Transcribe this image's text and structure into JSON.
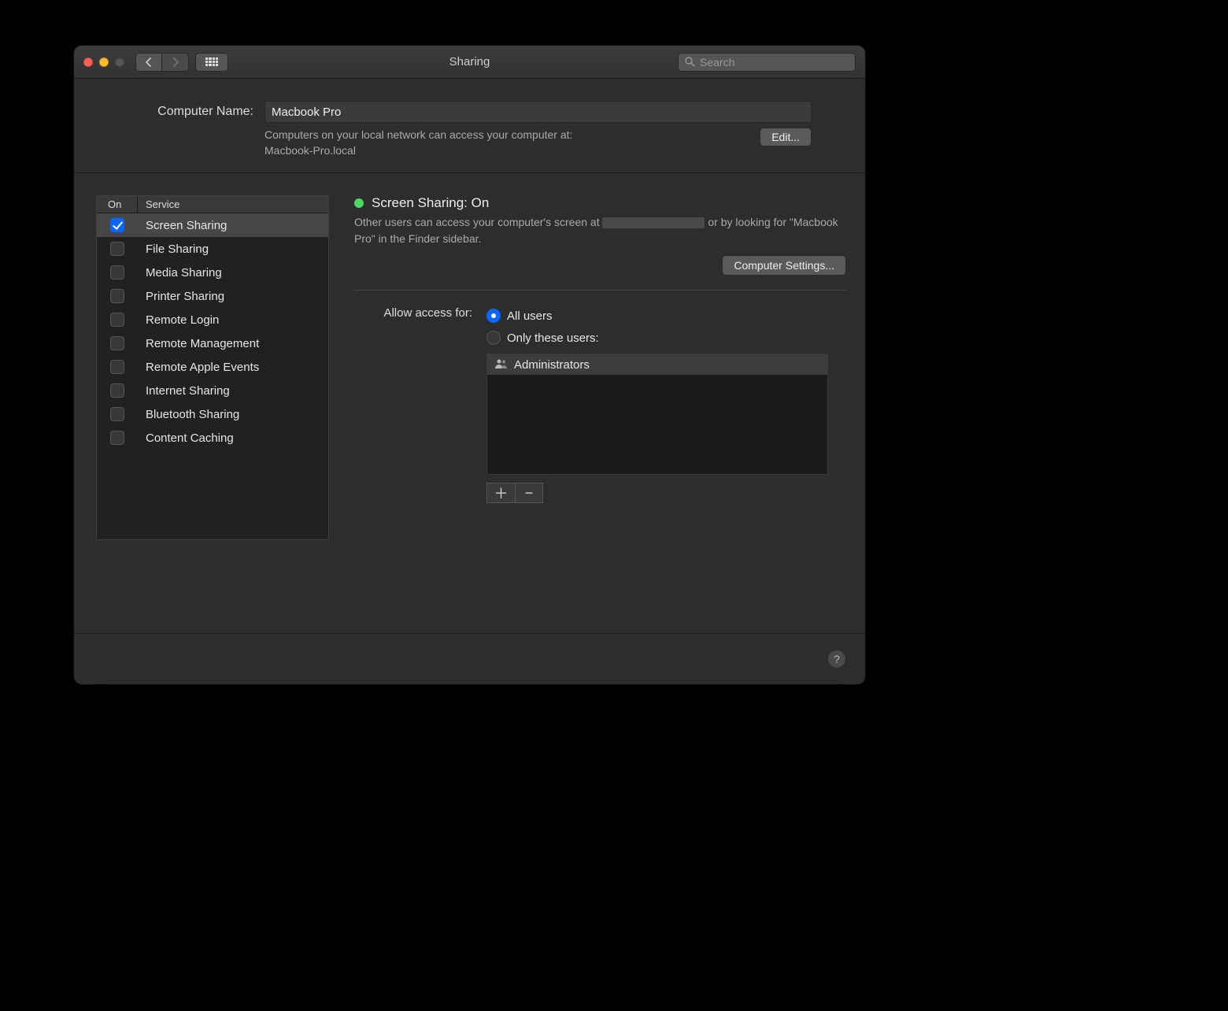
{
  "window": {
    "title": "Sharing"
  },
  "search": {
    "placeholder": "Search"
  },
  "computer_name": {
    "label": "Computer Name:",
    "value": "Macbook Pro",
    "sub_line1": "Computers on your local network can access your computer at:",
    "sub_line2": "Macbook-Pro.local",
    "edit_button": "Edit..."
  },
  "services": {
    "columns": {
      "on": "On",
      "service": "Service"
    },
    "items": [
      {
        "label": "Screen Sharing",
        "checked": true,
        "selected": true
      },
      {
        "label": "File Sharing",
        "checked": false,
        "selected": false
      },
      {
        "label": "Media Sharing",
        "checked": false,
        "selected": false
      },
      {
        "label": "Printer Sharing",
        "checked": false,
        "selected": false
      },
      {
        "label": "Remote Login",
        "checked": false,
        "selected": false
      },
      {
        "label": "Remote Management",
        "checked": false,
        "selected": false
      },
      {
        "label": "Remote Apple Events",
        "checked": false,
        "selected": false
      },
      {
        "label": "Internet Sharing",
        "checked": false,
        "selected": false
      },
      {
        "label": "Bluetooth Sharing",
        "checked": false,
        "selected": false
      },
      {
        "label": "Content Caching",
        "checked": false,
        "selected": false
      }
    ]
  },
  "detail": {
    "status_title": "Screen Sharing: On",
    "status_color": "#4cd964",
    "desc_pre": "Other users can access your computer's screen at ",
    "desc_post": " or by looking for \"Macbook Pro\" in the Finder sidebar.",
    "computer_settings_button": "Computer Settings...",
    "access_label": "Allow access for:",
    "option_all": "All users",
    "option_only": "Only these users:",
    "selected_option": "all",
    "users": [
      {
        "label": "Administrators"
      }
    ]
  },
  "help_tooltip": "?"
}
